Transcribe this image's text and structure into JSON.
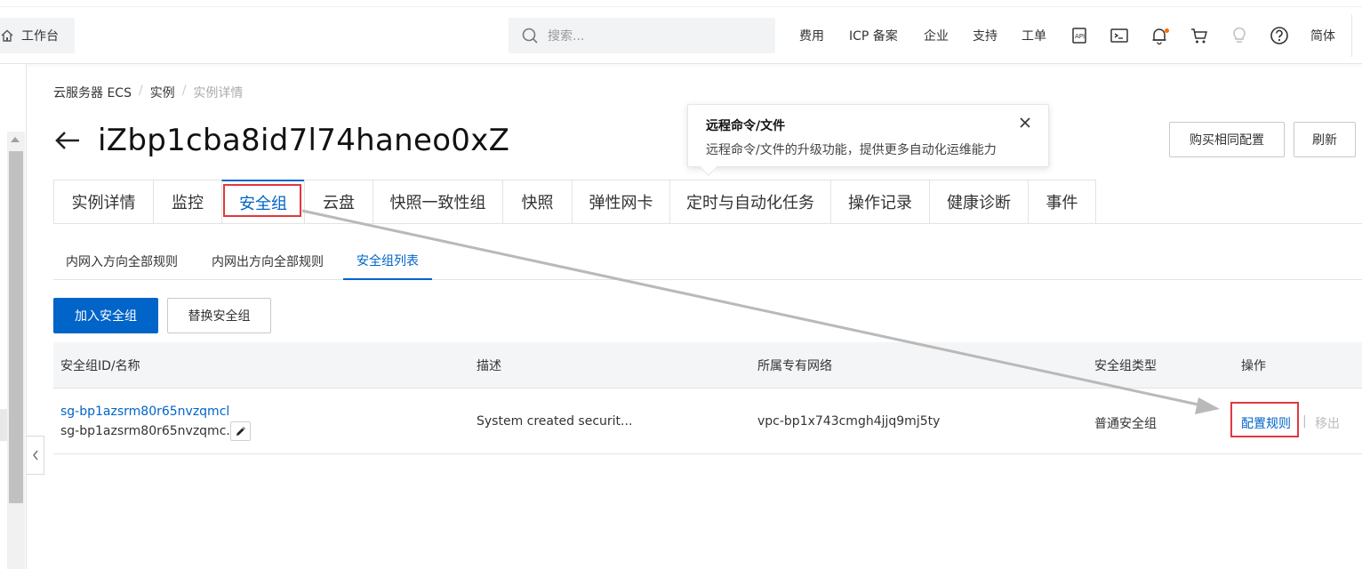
{
  "topbar": {
    "workbench_label": "工作台",
    "search_placeholder": "搜索...",
    "links": [
      "费用",
      "ICP 备案",
      "企业",
      "支持",
      "工单"
    ],
    "lang_label": "简体",
    "notification_dot_color": "#ff6a00"
  },
  "breadcrumb": [
    "云服务器 ECS",
    "实例",
    "实例详情"
  ],
  "breadcrumb_sep": "/",
  "page": {
    "title": "iZbp1cba8id7l74haneo0xZ",
    "buy_same_label": "购买相同配置",
    "refresh_label": "刷新"
  },
  "popover": {
    "title": "远程命令/文件",
    "description": "远程命令/文件的升级功能，提供更多自动化运维能力"
  },
  "tabs": [
    "实例详情",
    "监控",
    "安全组",
    "云盘",
    "快照一致性组",
    "快照",
    "弹性网卡",
    "定时与自动化任务",
    "操作记录",
    "健康诊断",
    "事件"
  ],
  "active_tab": "安全组",
  "subtabs": [
    "内网入方向全部规则",
    "内网出方向全部规则",
    "安全组列表"
  ],
  "active_subtab": "安全组列表",
  "actions": {
    "add_group": "加入安全组",
    "replace_group": "替换安全组"
  },
  "table": {
    "columns": [
      "安全组ID/名称",
      "描述",
      "所属专有网络",
      "安全组类型",
      "操作"
    ],
    "rows": [
      {
        "id": "sg-bp1azsrm80r65nvzqmcl",
        "name": "sg-bp1azsrm80r65nvzqmc...",
        "description": "System created securit...",
        "vpc": "vpc-bp1x743cmgh4jjq9mj5ty",
        "type": "普通安全组",
        "op_configure": "配置规则",
        "op_sep": "|",
        "op_remove": "移出"
      }
    ]
  },
  "colors": {
    "primary": "#0064c8",
    "annotation_red": "#e0393e",
    "annotation_arrow": "#b9b9b9"
  }
}
